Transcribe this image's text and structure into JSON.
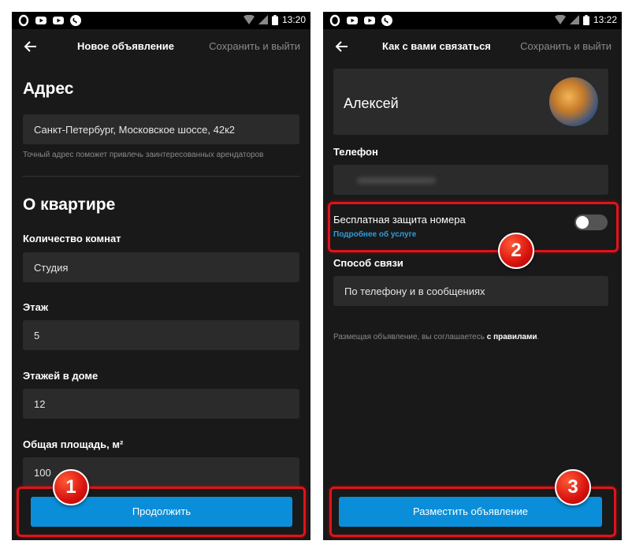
{
  "screen1": {
    "time": "13:20",
    "title": "Новое объявление",
    "action": "Сохранить и выйти",
    "address_heading": "Адрес",
    "address_value": "Санкт-Петербург, Московское шоссе, 42к2",
    "address_hint": "Точный адрес поможет привлечь заинтересованных арендаторов",
    "apartment_heading": "О квартире",
    "rooms_label": "Количество комнат",
    "rooms_value": "Студия",
    "floor_label": "Этаж",
    "floor_value": "5",
    "floors_label": "Этажей в доме",
    "floors_value": "12",
    "area_label": "Общая площадь, м²",
    "area_value": "100",
    "continue_label": "Продолжить",
    "badge": "1"
  },
  "screen2": {
    "time": "13:22",
    "title": "Как с вами связаться",
    "action": "Сохранить и выйти",
    "name": "Алексей",
    "phone_label": "Телефон",
    "protection_label": "Бесплатная защита номера",
    "protection_link": "Подробнее об услуге",
    "protection_enabled": false,
    "contact_label": "Способ связи",
    "contact_value": "По телефону и в сообщениях",
    "terms_prefix": "Размещая объявление, вы соглашаетесь ",
    "terms_link": "с правилами",
    "terms_suffix": ".",
    "publish_label": "Разместить объявление",
    "badge2": "2",
    "badge3": "3"
  },
  "colors": {
    "background": "#191919",
    "field": "#2b2b2b",
    "accent": "#0a8ed9",
    "highlight": "#e0131b",
    "link": "#2d9cdb"
  }
}
